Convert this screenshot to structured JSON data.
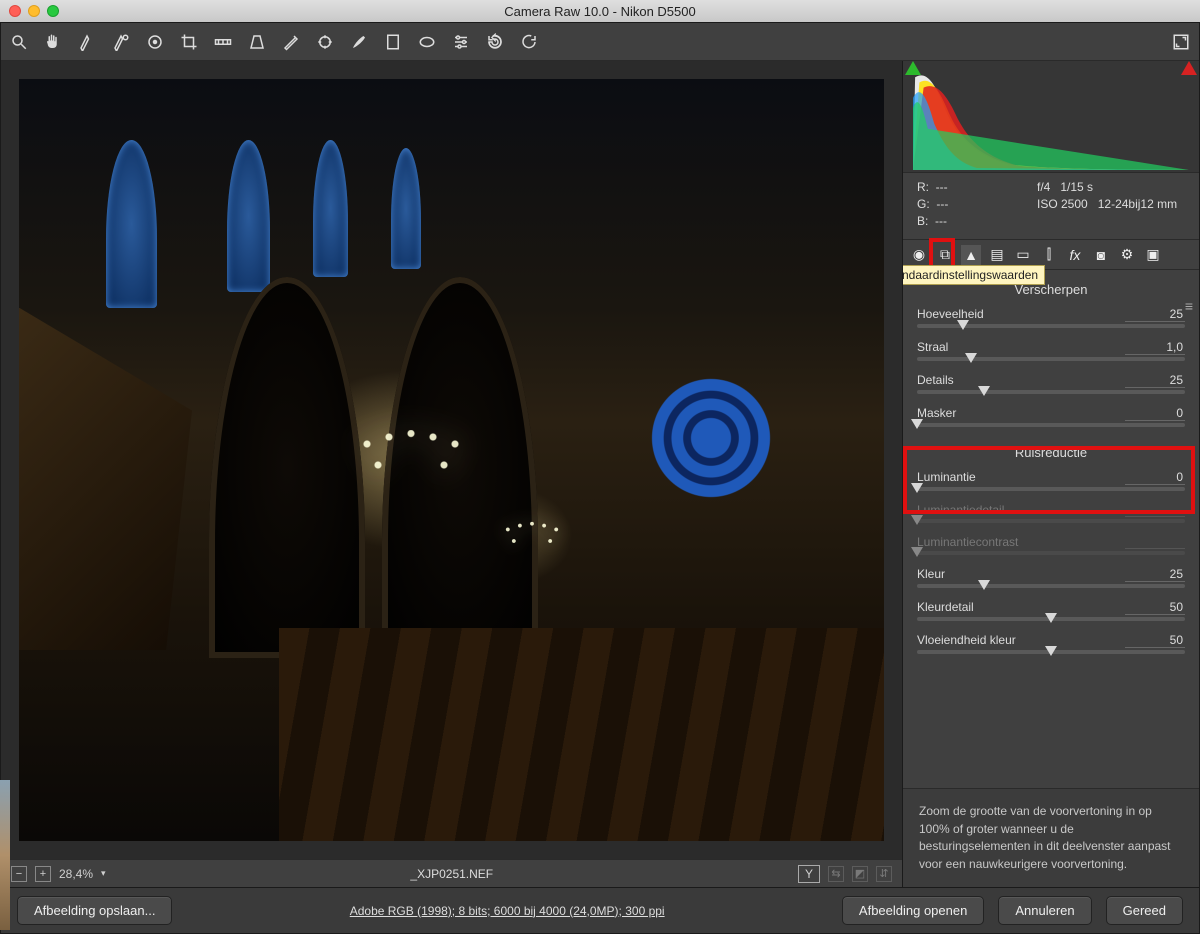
{
  "window": {
    "title": "Camera Raw 10.0  -  Nikon D5500"
  },
  "status": {
    "zoom": "28,4%",
    "filename": "_XJP0251.NEF"
  },
  "exif": {
    "r_label": "R:",
    "r_val": "---",
    "g_label": "G:",
    "g_val": "---",
    "b_label": "B:",
    "b_val": "---",
    "aperture": "f/4",
    "shutter": "1/15 s",
    "iso": "ISO 2500",
    "lens": "12-24bij12 mm"
  },
  "tooltip": "Standaardinstellingswaarden",
  "panel": {
    "sharpen_title": "Verscherpen",
    "amount_label": "Hoeveelheid",
    "amount_val": "25",
    "radius_label": "Straal",
    "radius_val": "1,0",
    "detail_label": "Details",
    "detail_val": "25",
    "mask_label": "Masker",
    "mask_val": "0",
    "noise_title": "Ruisreductie",
    "lum_label": "Luminantie",
    "lum_val": "0",
    "lumdet_label": "Luminantiedetail",
    "lumdet_val": "",
    "lumcon_label": "Luminantiecontrast",
    "lumcon_val": "",
    "color_label": "Kleur",
    "color_val": "25",
    "coldet_label": "Kleurdetail",
    "coldet_val": "50",
    "smooth_label": "Vloeiendheid kleur",
    "smooth_val": "50"
  },
  "hint": "Zoom de grootte van de voorvertoning in op 100% of groter wanneer u de besturingselementen in dit deelvenster aanpast voor een nauwkeurigere voorvertoning.",
  "bottom": {
    "save": "Afbeelding opslaan...",
    "settings": "Adobe RGB (1998); 8 bits; 6000 bij 4000 (24,0MP); 300 ppi",
    "open": "Afbeelding openen",
    "cancel": "Annuleren",
    "done": "Gereed"
  }
}
